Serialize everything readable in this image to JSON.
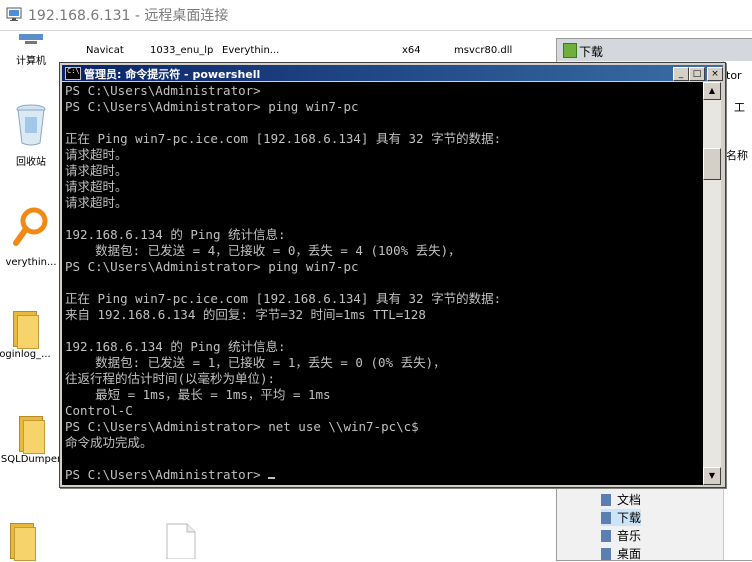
{
  "window": {
    "title": "192.168.6.131 - 远程桌面连接"
  },
  "desktop": {
    "icons": [
      {
        "label": "计算机",
        "icon": "computer-icon"
      },
      {
        "label": "回收站",
        "icon": "recycle-bin-icon"
      },
      {
        "label": "verythin...",
        "icon": "everything-icon"
      },
      {
        "label": "oginlog_...",
        "icon": "folder-icon"
      },
      {
        "label": "SQLDumper",
        "icon": "folder-icon"
      }
    ],
    "top_labels": [
      "Navicat",
      "1033_enu_lp",
      "Everythin...",
      "x64",
      "msvcr80.dll"
    ]
  },
  "explorer": {
    "title": "下载",
    "side_texts": [
      "tor",
      "工",
      "名称"
    ],
    "nav_items": [
      "文档",
      "下载",
      "音乐",
      "桌面"
    ],
    "selected": "下载"
  },
  "console": {
    "title": "管理员: 命令提示符 - powershell",
    "buttons": {
      "minimize": "_",
      "maximize": "□",
      "close": "×"
    },
    "lines": [
      "PS C:\\Users\\Administrator>",
      "PS C:\\Users\\Administrator> ping win7-pc",
      "",
      "正在 Ping win7-pc.ice.com [192.168.6.134] 具有 32 字节的数据:",
      "请求超时。",
      "请求超时。",
      "请求超时。",
      "请求超时。",
      "",
      "192.168.6.134 的 Ping 统计信息:",
      "    数据包: 已发送 = 4，已接收 = 0，丢失 = 4 (100% 丢失)，",
      "PS C:\\Users\\Administrator> ping win7-pc",
      "",
      "正在 Ping win7-pc.ice.com [192.168.6.134] 具有 32 字节的数据:",
      "来自 192.168.6.134 的回复: 字节=32 时间=1ms TTL=128",
      "",
      "192.168.6.134 的 Ping 统计信息:",
      "    数据包: 已发送 = 1，已接收 = 1，丢失 = 0 (0% 丢失)，",
      "往返行程的估计时间(以毫秒为单位):",
      "    最短 = 1ms，最长 = 1ms，平均 = 1ms",
      "Control-C",
      "PS C:\\Users\\Administrator> net use \\\\win7-pc\\c$",
      "命令成功完成。",
      "",
      "PS C:\\Users\\Administrator> "
    ]
  }
}
